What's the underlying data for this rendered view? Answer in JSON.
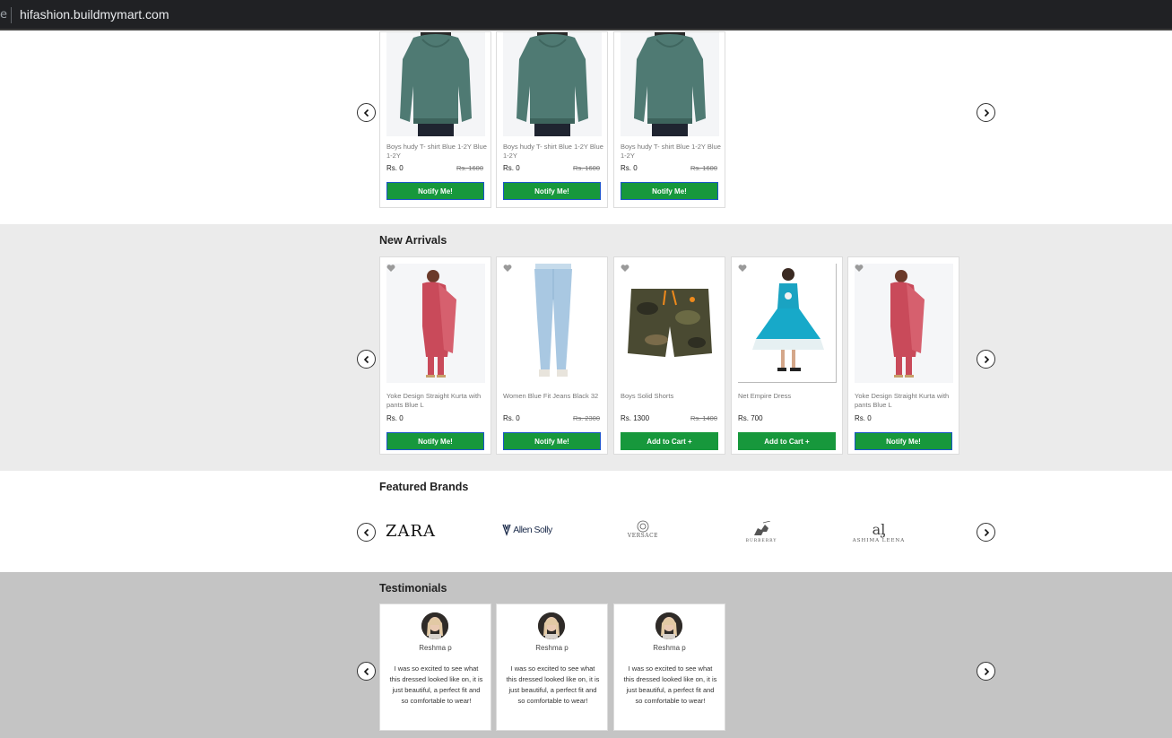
{
  "browser": {
    "edge_glyph": "e",
    "url": "hifashion.buildmymart.com"
  },
  "top_products": [
    {
      "name": "Boys hudy T- shirt Blue 1-2Y Blue 1-2Y",
      "price": "Rs. 0",
      "mrp": "Rs. 1600",
      "button": "Notify Me!"
    },
    {
      "name": "Boys hudy T- shirt Blue 1-2Y Blue 1-2Y",
      "price": "Rs. 0",
      "mrp": "Rs. 1600",
      "button": "Notify Me!"
    },
    {
      "name": "Boys hudy T- shirt Blue 1-2Y Blue 1-2Y",
      "price": "Rs. 0",
      "mrp": "Rs. 1600",
      "button": "Notify Me!"
    }
  ],
  "new_arrivals": {
    "title": "New Arrivals",
    "items": [
      {
        "name": "Yoke Design Straight Kurta with pants Blue L",
        "price": "Rs. 0",
        "mrp": "",
        "button": "Notify Me!"
      },
      {
        "name": "Women Blue Fit Jeans Black 32",
        "price": "Rs. 0",
        "mrp": "Rs. 2300",
        "button": "Notify Me!"
      },
      {
        "name": "Boys Solid Shorts",
        "price": "Rs. 1300",
        "mrp": "Rs. 1400",
        "button": "Add to Cart +"
      },
      {
        "name": "Net Empire Dress",
        "price": "Rs. 700",
        "mrp": "",
        "button": "Add to Cart +"
      },
      {
        "name": "Yoke Design Straight Kurta with pants Blue L",
        "price": "Rs. 0",
        "mrp": "",
        "button": "Notify Me!"
      }
    ]
  },
  "featured_brands": {
    "title": "Featured Brands",
    "brands": [
      "ZARA",
      "Allen Solly",
      "VERSACE",
      "BURBERRY",
      "ASHIMA LEENA"
    ]
  },
  "testimonials": {
    "title": "Testimonials",
    "items": [
      {
        "name": "Reshma p",
        "text": "I was so excited to see what this dressed looked like on, it is just beautiful, a perfect fit and so comfortable to wear!"
      },
      {
        "name": "Reshma p",
        "text": "I was so excited to see what this dressed looked like on, it is just beautiful, a perfect fit and so comfortable to wear!"
      },
      {
        "name": "Reshma p",
        "text": "I was so excited to see what this dressed looked like on, it is just beautiful, a perfect fit and so comfortable to wear!"
      }
    ]
  },
  "icons": {
    "prev": "chevron-left-icon",
    "next": "chevron-right-icon",
    "wishlist": "heart-icon"
  },
  "colors": {
    "button_green": "#17983c",
    "button_border_blue": "#1a55c8",
    "section_light_gray": "#ebebeb",
    "section_gray": "#c4c4c4"
  }
}
